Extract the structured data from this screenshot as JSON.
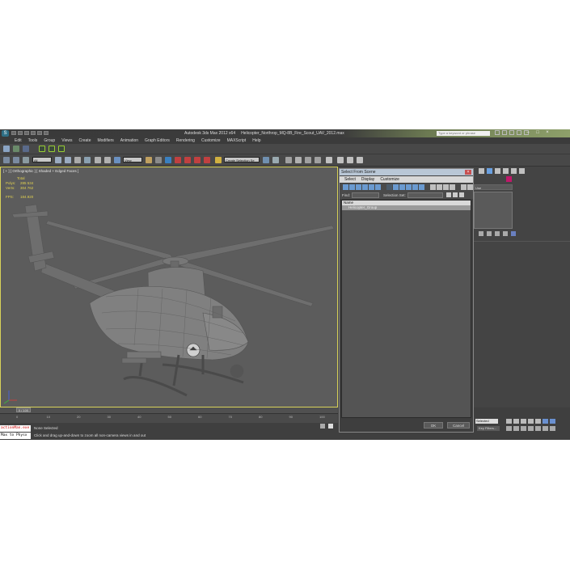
{
  "titlebar": {
    "app_title": "Autodesk 3ds Max 2012 x64",
    "file_name": "Helicopter_Northrop_MQ-8B_Fire_Scout_UAV_2012.max",
    "search_placeholder": "Type a keyword or phrase"
  },
  "menu": [
    "Edit",
    "Tools",
    "Group",
    "Views",
    "Create",
    "Modifiers",
    "Animation",
    "Graph Editors",
    "Rendering",
    "Customize",
    "MAXScript",
    "Help"
  ],
  "toolbar": {
    "selection_filter": "All",
    "view_dropdown": "View",
    "named_selection": "Create Selection Se"
  },
  "viewport": {
    "label": "[ + ] [ Orthographic ] [ Shaded + Edged Faces ]",
    "stats": {
      "total_label": "Total",
      "polys_label": "Polys:",
      "polys_value": "285 534",
      "verts_label": "Verts:",
      "verts_value": "304 762",
      "fps_label": "FPS:",
      "fps_value": "184.920"
    }
  },
  "timeline": {
    "frame_counter": "0 / 100",
    "ticks": [
      "0",
      "10",
      "20",
      "30",
      "40",
      "50",
      "60",
      "70",
      "80",
      "90",
      "100"
    ]
  },
  "status": {
    "script_line_1": "actionMan.exe",
    "script_line_2": "Max to Physx",
    "selection": "None Selected",
    "prompt": "Click and drag up-and-down to zoom all non-camera views in and out"
  },
  "bottom_right": {
    "auto_key": "Auto Key",
    "set_key_dropdown": "Selected",
    "key_filters": "Key Filters...",
    "add_time_tag": "Add Time Tag"
  },
  "dialog": {
    "title": "Select From Scene",
    "menu": [
      "Select",
      "Display",
      "Customize"
    ],
    "find_label": "Find:",
    "find_value": "",
    "selection_set_label": "Selection Set:",
    "column_header": "Name",
    "items": [
      "Helicopter_Group"
    ],
    "ok_label": "OK",
    "cancel_label": "Cancel"
  },
  "command_panel": {
    "dropdown": "Use"
  },
  "colors": {
    "ui_bg": "#444444",
    "viewport_bg": "#5c5c5c",
    "active_border": "#d8d25a",
    "stats_text": "#e0d050",
    "dialog_title": "#b9c7d6",
    "cancel_red": "#c75050"
  }
}
